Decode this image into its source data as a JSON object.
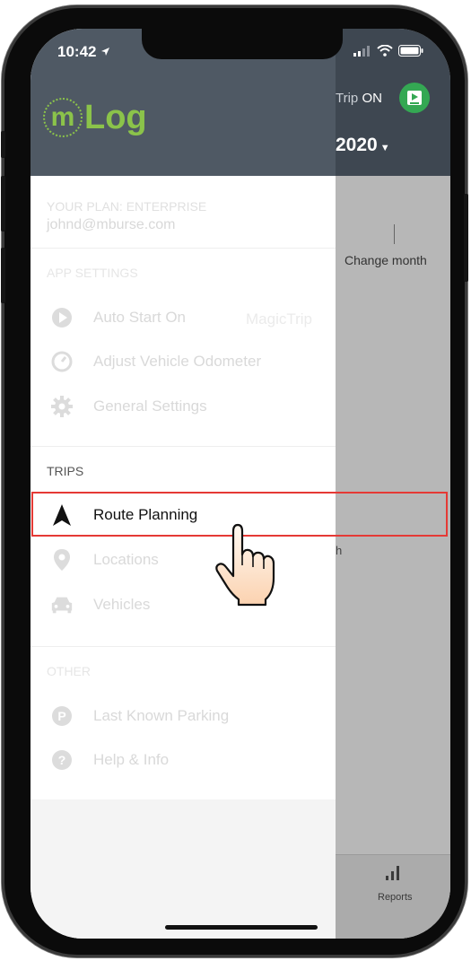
{
  "status_bar": {
    "time": "10:42"
  },
  "background_app": {
    "trip_status_prefix": "Trip",
    "trip_status_value": "ON",
    "year": "2020",
    "change_month": "Change month",
    "stray_text": "h",
    "tab_reports": "Reports"
  },
  "drawer": {
    "logo_m": "m",
    "logo_text": "Log",
    "plan_label": "YOUR PLAN: ENTERPRISE",
    "email": "johnd@mburse.com",
    "sections": {
      "app_settings": "APP SETTINGS",
      "trips": "TRIPS",
      "other": "OTHER"
    },
    "items": {
      "auto_start": "Auto Start On",
      "auto_start_mode": "MagicTrip",
      "adjust_odometer": "Adjust Vehicle Odometer",
      "general_settings": "General Settings",
      "route_planning": "Route Planning",
      "locations": "Locations",
      "vehicles": "Vehicles",
      "last_parking": "Last Known Parking",
      "help_info": "Help & Info"
    }
  },
  "colors": {
    "brand_green": "#8bc34a",
    "header_grey": "#4f5964",
    "highlight_red": "#e53935",
    "app_green": "#34a853"
  }
}
